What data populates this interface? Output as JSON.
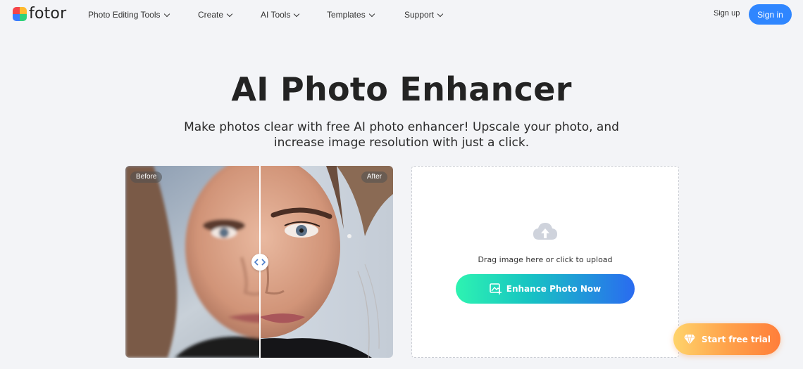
{
  "header": {
    "logo_text": "fotor",
    "nav": [
      {
        "label": "Photo Editing Tools"
      },
      {
        "label": "Create"
      },
      {
        "label": "AI Tools"
      },
      {
        "label": "Templates"
      },
      {
        "label": "Support"
      }
    ],
    "signup_label": "Sign up",
    "signin_label": "Sign in"
  },
  "hero": {
    "title": "AI Photo Enhancer",
    "subtitle_line1": "Make photos clear with free AI photo enhancer! Upscale your photo, and",
    "subtitle_line2": "increase image resolution with just a click."
  },
  "compare": {
    "before_label": "Before",
    "after_label": "After"
  },
  "upload": {
    "hint": "Drag image here or click to upload",
    "button_label": "Enhance Photo Now"
  },
  "trial": {
    "label": "Start free trial"
  },
  "colors": {
    "accent": "#2f86ff",
    "page_bg": "#f3f4f7",
    "trial_orange": "#ff8a3d"
  },
  "icons": {
    "upload": "cloud-upload-icon",
    "enhance": "image-plus-icon",
    "trial": "diamond-icon",
    "compare_handle": "arrows-left-right-icon"
  }
}
